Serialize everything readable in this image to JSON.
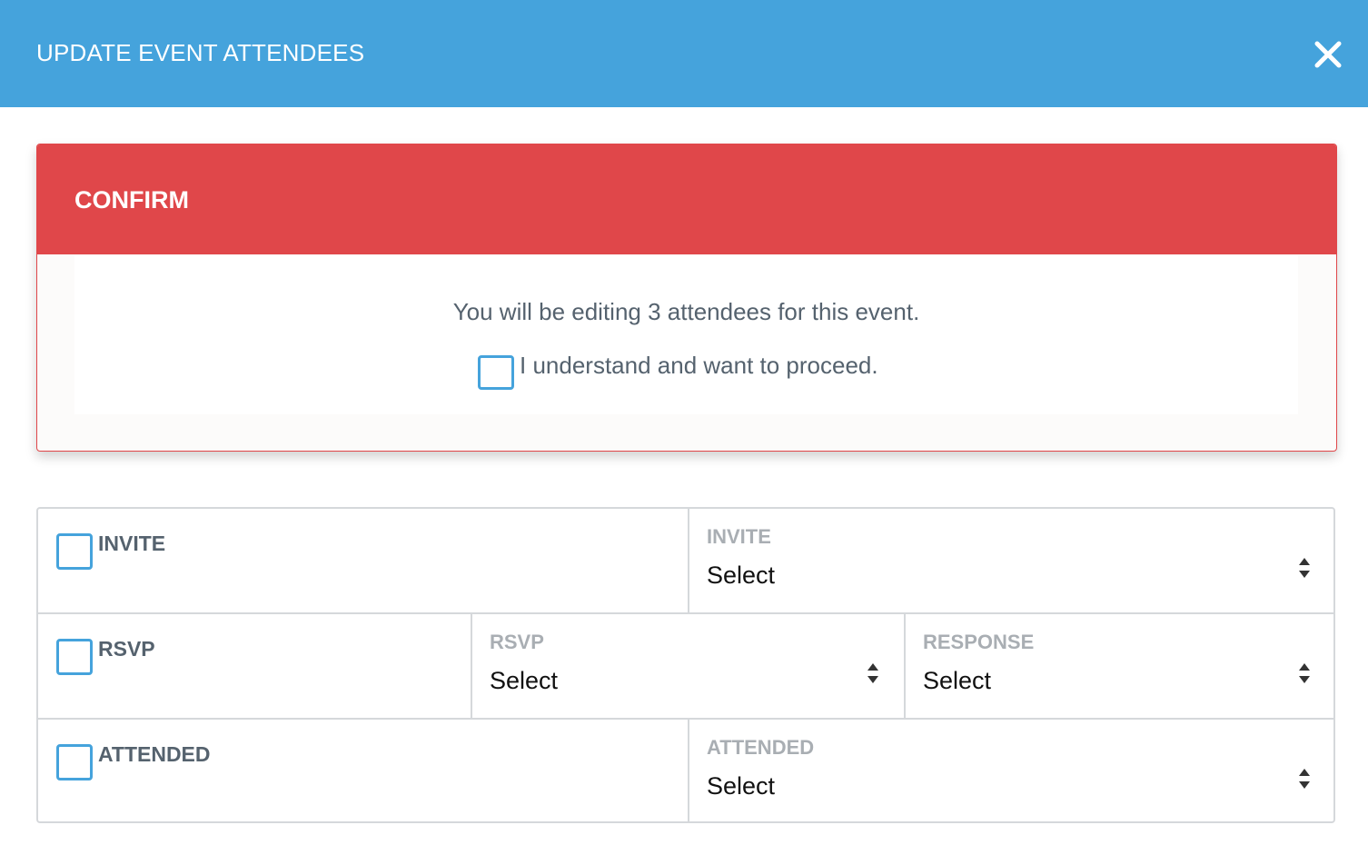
{
  "header": {
    "title": "UPDATE EVENT ATTENDEES",
    "close_icon": "close-icon",
    "background": "#45a3dc"
  },
  "confirm": {
    "title": "CONFIRM",
    "message": "You will be editing 3 attendees for this event.",
    "checkbox_label": "I understand and want to proceed.",
    "checked": false,
    "accent": "#e0474a"
  },
  "rows": {
    "invite": {
      "label": "INVITE",
      "checked": false,
      "field_label": "INVITE",
      "value": "Select"
    },
    "rsvp": {
      "label": "RSVP",
      "checked": false,
      "field_label": "RSVP",
      "value": "Select",
      "response_label": "RESPONSE",
      "response_value": "Select"
    },
    "attended": {
      "label": "ATTENDED",
      "checked": false,
      "field_label": "ATTENDED",
      "value": "Select"
    }
  },
  "icons": {
    "select_arrows": "up-down-arrows-icon",
    "checkbox": "checkbox-icon"
  }
}
